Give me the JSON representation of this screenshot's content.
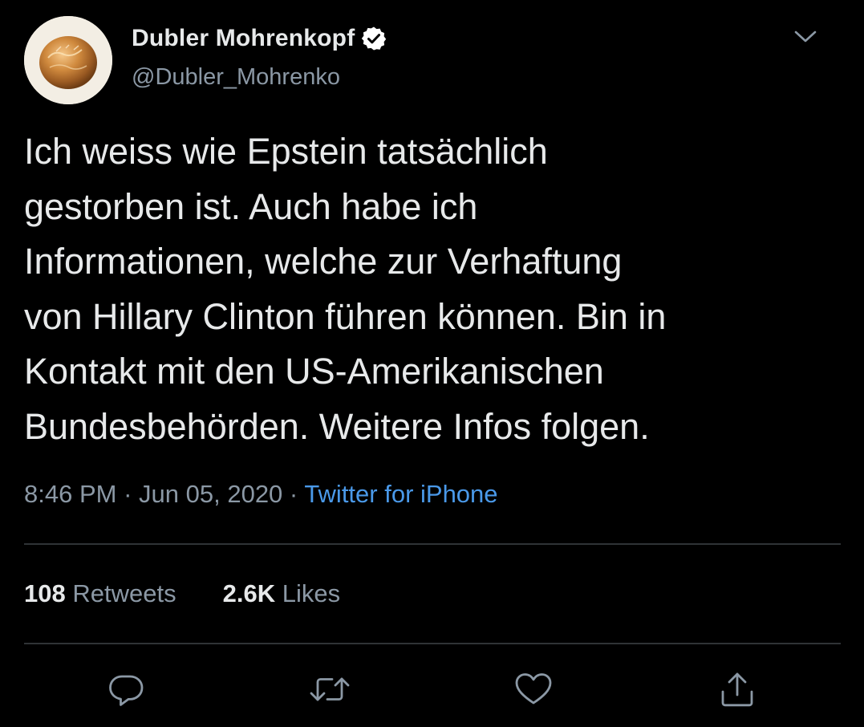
{
  "user": {
    "display_name": "Dubler Mohrenkopf",
    "handle": "@Dubler_Mohrenko",
    "verified": true,
    "avatar_icon": "chocolate-ball-avatar"
  },
  "tweet": {
    "text_lines": [
      "Ich weiss wie Epstein tatsächlich",
      "gestorben ist. Auch habe ich",
      "Informationen, welche zur Verhaftung",
      "von Hillary Clinton führen können. Bin in",
      "Kontakt mit den US-Amerikanischen",
      "Bundesbehörden. Weitere Infos folgen."
    ],
    "time": "8:46 PM",
    "separator": "·",
    "date": "Jun 05, 2020",
    "source": "Twitter for iPhone"
  },
  "stats": {
    "retweets_count": "108",
    "retweets_label": "Retweets",
    "likes_count": "2.6K",
    "likes_label": "Likes"
  },
  "actions": {
    "reply_icon": "speech-bubble-icon",
    "retweet_icon": "retweet-arrows-icon",
    "like_icon": "heart-icon",
    "share_icon": "share-upload-icon"
  },
  "colors": {
    "background": "#000000",
    "text_primary": "#e7e9ea",
    "text_secondary": "#8b98a5",
    "link": "#4a99e9",
    "divider": "#2f3336"
  }
}
